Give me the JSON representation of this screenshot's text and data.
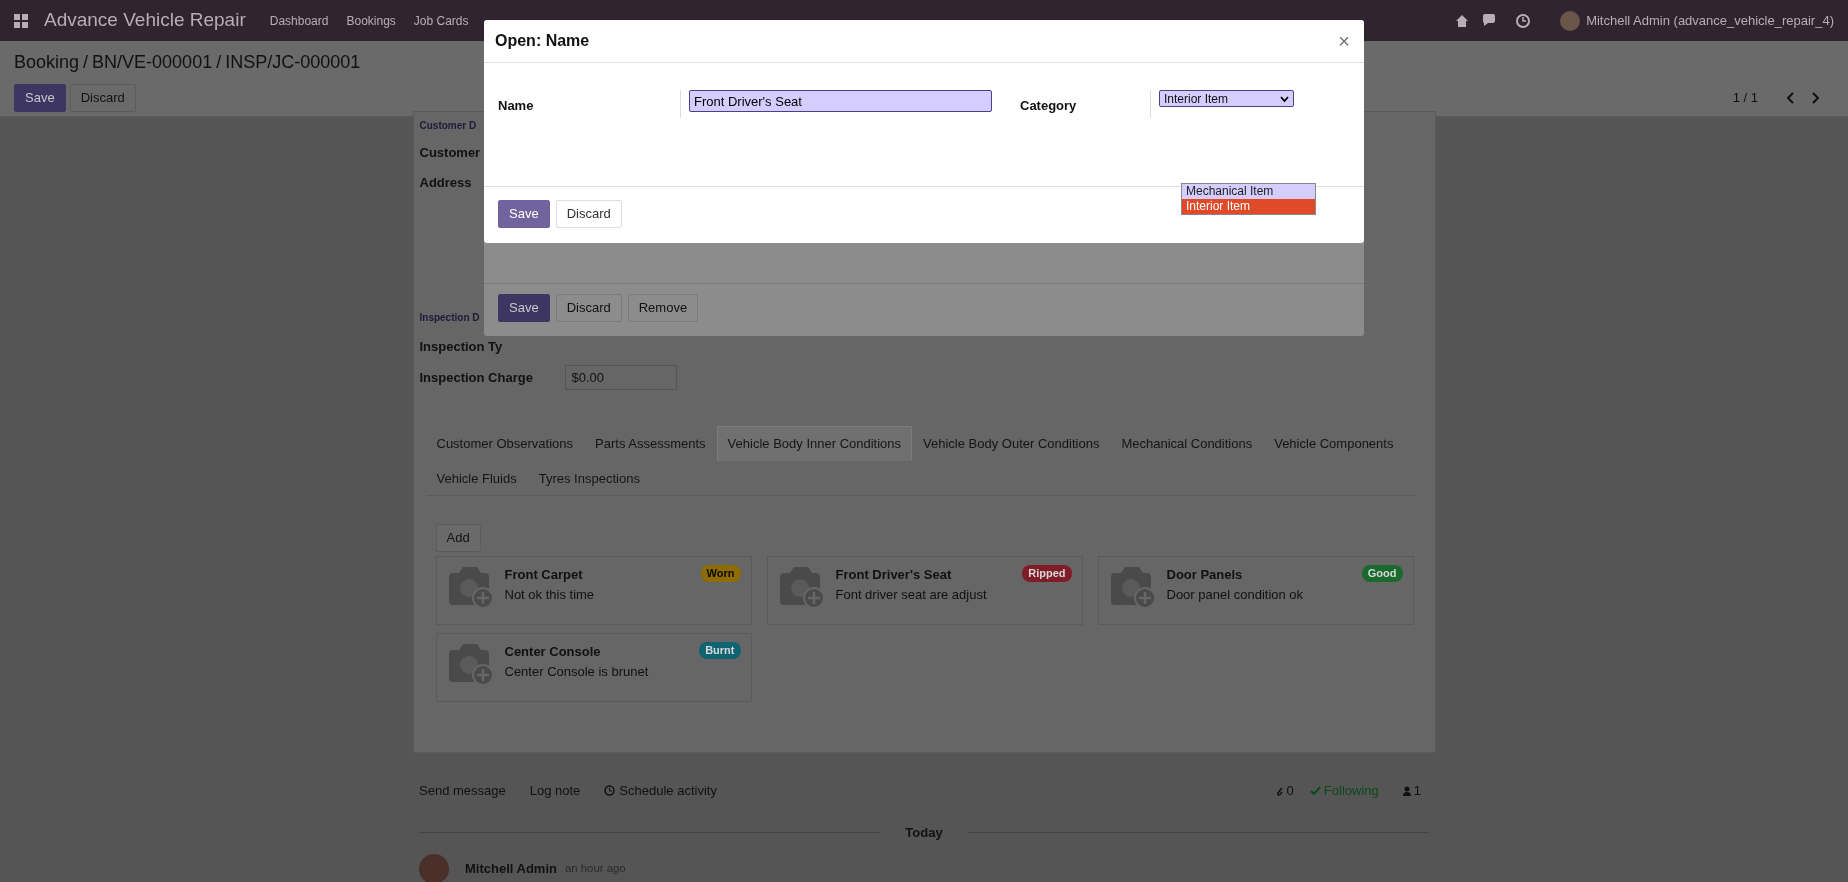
{
  "navbar": {
    "app_title": "Advance Vehicle Repair",
    "menu": [
      "Dashboard",
      "Bookings",
      "Job Cards"
    ],
    "user": "Mitchell Admin (advance_vehicle_repair_4)"
  },
  "breadcrumb": {
    "separator": "/",
    "items": [
      "Booking",
      "BN/VE-000001",
      "INSP/JC-000001"
    ]
  },
  "form_buttons": [
    {
      "label": "Save",
      "kind": "primary"
    },
    {
      "label": "Discard",
      "kind": "secondary"
    }
  ],
  "pager": "1 / 1",
  "customer_section": {
    "title": "Customer D",
    "fields": [
      "Customer",
      "Address"
    ]
  },
  "inspection_section": {
    "title": "Inspection D",
    "fields": [
      {
        "label": "Inspection Ty"
      },
      {
        "label": "Inspection Charge",
        "value": "$0.00"
      }
    ]
  },
  "tabs": [
    {
      "label": "Customer Observations",
      "selected": false
    },
    {
      "label": "Parts Assessments",
      "selected": false
    },
    {
      "label": "Vehicle Body Inner Conditions",
      "selected": true
    },
    {
      "label": "Vehicle Body Outer Conditions",
      "selected": false
    },
    {
      "label": "Mechanical Conditions",
      "selected": false
    },
    {
      "label": "Vehicle Components",
      "selected": false
    },
    {
      "label": "Vehicle Fluids",
      "selected": false
    },
    {
      "label": "Tyres Inspections",
      "selected": false
    }
  ],
  "add_button": "Add",
  "cards": [
    {
      "name": "Front Carpet",
      "note": "Not ok this time",
      "badge": "Worn",
      "color": "#8f6c00"
    },
    {
      "name": "Front Driver's Seat",
      "note": "Font driver seat are adjust",
      "badge": "Ripped",
      "color": "#801c27"
    },
    {
      "name": "Door Panels",
      "note": "Door panel condition ok",
      "badge": "Good",
      "color": "#1b6a2d"
    },
    {
      "name": "Center Console",
      "note": "Center Console is brunet",
      "badge": "Burnt",
      "color": "#0e6470"
    }
  ],
  "chatter": {
    "actions": [
      "Send message",
      "Log note",
      "Schedule activity"
    ],
    "attachments": "0",
    "following": "Following",
    "followers": "1",
    "date_separator": "Today",
    "message": {
      "author": "Mitchell Admin",
      "time": "an hour ago"
    }
  },
  "line_dialog": {
    "buttons": [
      {
        "label": "Save",
        "kind": "primary"
      },
      {
        "label": "Discard",
        "kind": "secondary"
      },
      {
        "label": "Remove",
        "kind": "secondary"
      }
    ]
  },
  "name_dialog": {
    "title": "Open: Name",
    "close": "×",
    "name_label": "Name",
    "name_value": "Front Driver's Seat",
    "category_label": "Category",
    "category_value": "Interior Item",
    "options": [
      {
        "label": "Mechanical Item",
        "selected": false
      },
      {
        "label": "Interior Item",
        "selected": true
      }
    ],
    "buttons": [
      {
        "label": "Save",
        "kind": "primary"
      },
      {
        "label": "Discard",
        "kind": "secondary"
      }
    ]
  }
}
